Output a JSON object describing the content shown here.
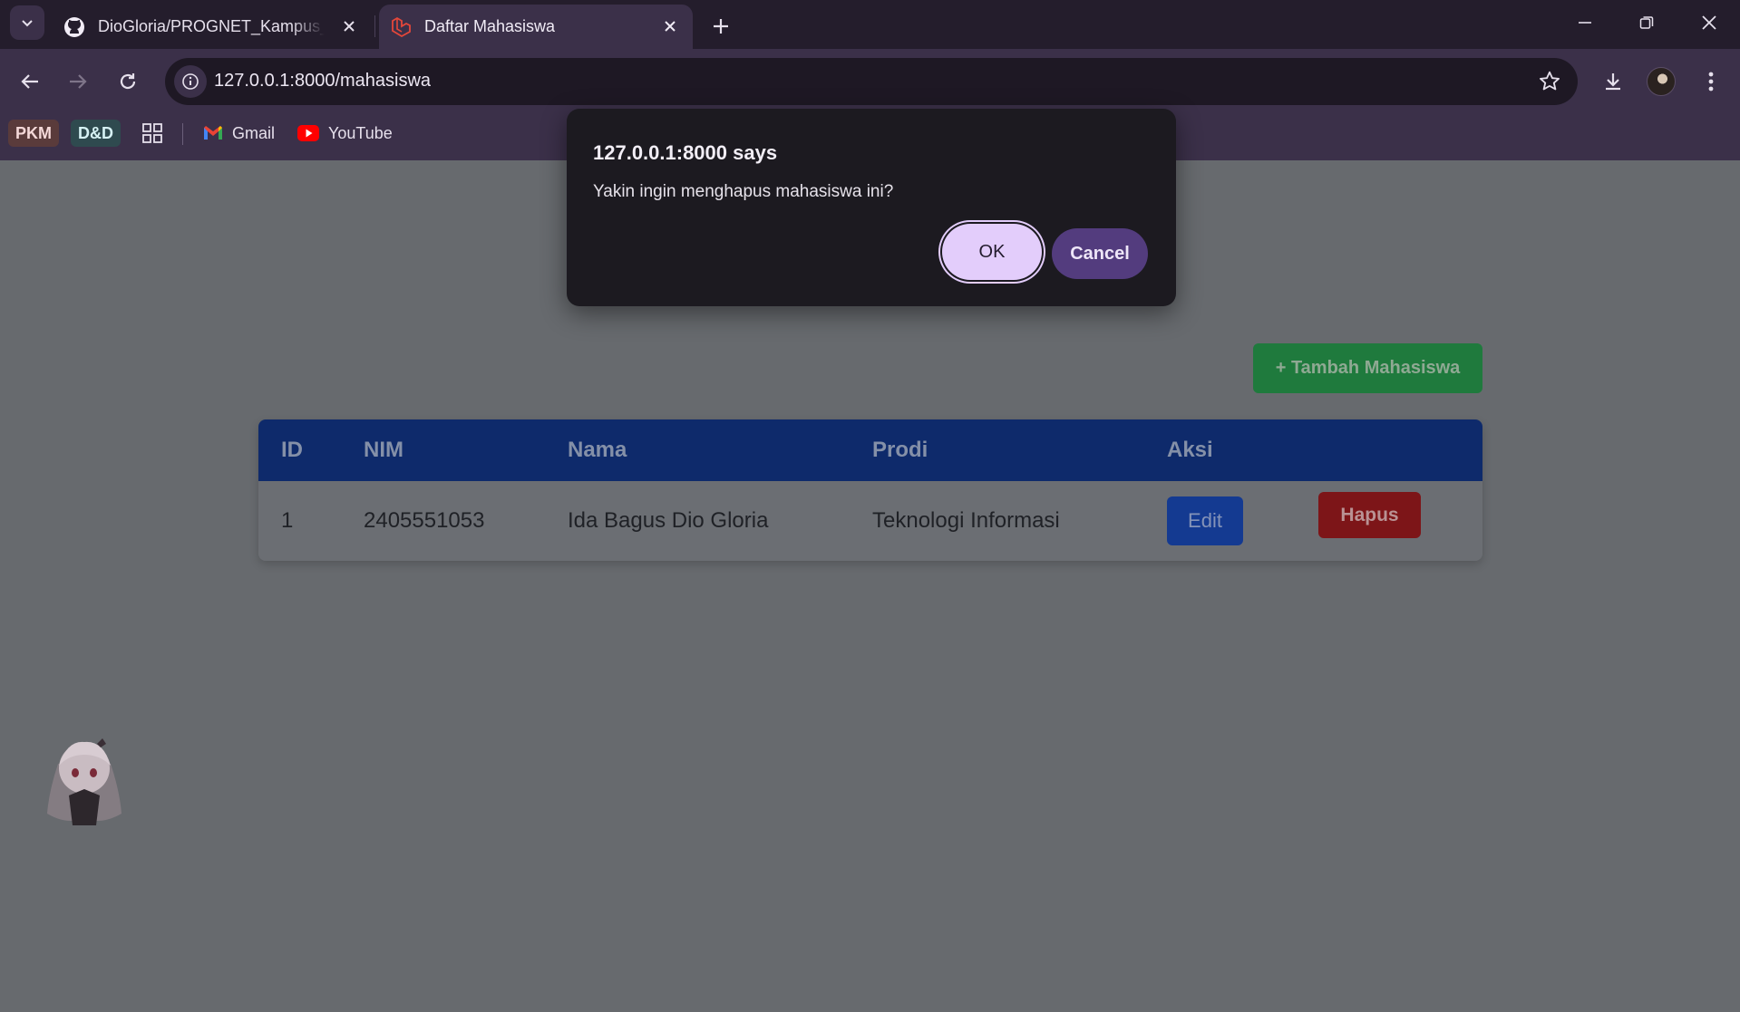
{
  "browser": {
    "tabs": [
      {
        "title": "DioGloria/PROGNET_Kampus_L",
        "icon": "github-icon",
        "active": false
      },
      {
        "title": "Daftar Mahasiswa",
        "icon": "laravel-icon",
        "active": true
      }
    ],
    "url": "127.0.0.1:8000/mahasiswa",
    "bookmarks": {
      "chip1": "PKM",
      "chip2": "D&D",
      "gmail": "Gmail",
      "youtube": "YouTube"
    },
    "colors": {
      "frame": "#241d2c",
      "toolbar": "#3b3049",
      "omnibox": "#1e1824"
    }
  },
  "page": {
    "add_button": "+ Tambah Mahasiswa",
    "table": {
      "headers": [
        "ID",
        "NIM",
        "Nama",
        "Prodi",
        "Aksi"
      ],
      "rows": [
        {
          "id": "1",
          "nim": "2405551053",
          "nama": "Ida Bagus Dio Gloria",
          "prodi": "Teknologi Informasi",
          "edit": "Edit",
          "hapus": "Hapus"
        }
      ]
    },
    "colors": {
      "header": "#0e2a6b",
      "add": "#1f7a3d",
      "edit": "#143a91",
      "delete": "#7d1518"
    }
  },
  "dialog": {
    "title": "127.0.0.1:8000 says",
    "message": "Yakin ingin menghapus mahasiswa ini?",
    "ok": "OK",
    "cancel": "Cancel",
    "colors": {
      "ok": "#e3cdfb",
      "cancel": "#533c7e"
    }
  }
}
